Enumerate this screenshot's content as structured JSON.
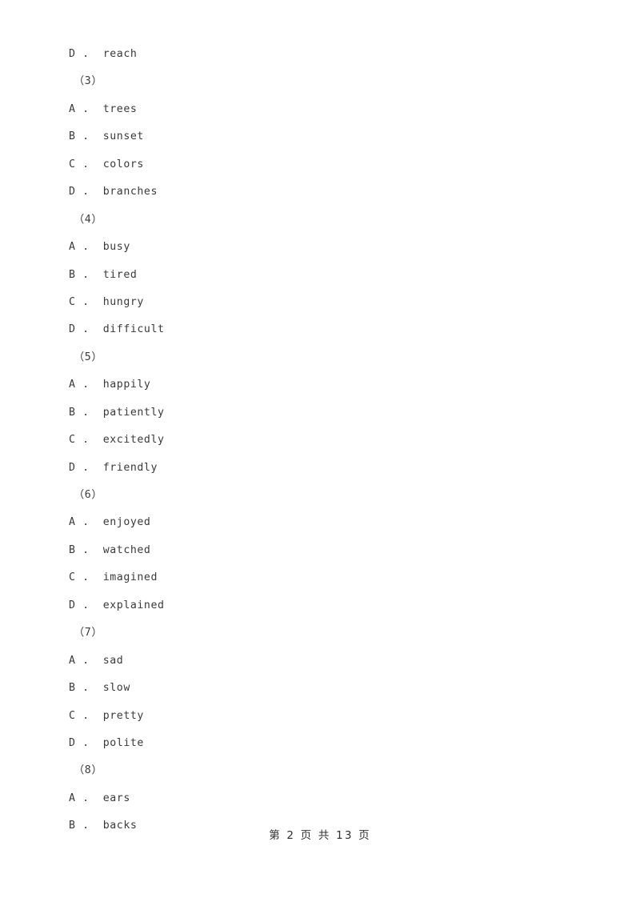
{
  "page": {
    "background_color": "#ffffff",
    "text_color": "#3a3a3a"
  },
  "document": {
    "lines": [
      {
        "kind": "option",
        "letter": "D",
        "separator": " . ",
        "text": "reach",
        "full": "D .  reach"
      },
      {
        "kind": "question",
        "number": "（3）",
        "full": "（3）"
      },
      {
        "kind": "option",
        "letter": "A",
        "separator": " . ",
        "text": "trees",
        "full": "A .  trees"
      },
      {
        "kind": "option",
        "letter": "B",
        "separator": " . ",
        "text": "sunset",
        "full": "B .  sunset"
      },
      {
        "kind": "option",
        "letter": "C",
        "separator": " . ",
        "text": "colors",
        "full": "C .  colors"
      },
      {
        "kind": "option",
        "letter": "D",
        "separator": " . ",
        "text": "branches",
        "full": "D .  branches"
      },
      {
        "kind": "question",
        "number": "（4）",
        "full": "（4）"
      },
      {
        "kind": "option",
        "letter": "A",
        "separator": " . ",
        "text": "busy",
        "full": "A .  busy"
      },
      {
        "kind": "option",
        "letter": "B",
        "separator": " . ",
        "text": "tired",
        "full": "B .  tired"
      },
      {
        "kind": "option",
        "letter": "C",
        "separator": " . ",
        "text": "hungry",
        "full": "C .  hungry"
      },
      {
        "kind": "option",
        "letter": "D",
        "separator": " . ",
        "text": "difficult",
        "full": "D .  difficult"
      },
      {
        "kind": "question",
        "number": "（5）",
        "full": "（5）"
      },
      {
        "kind": "option",
        "letter": "A",
        "separator": " . ",
        "text": "happily",
        "full": "A .  happily"
      },
      {
        "kind": "option",
        "letter": "B",
        "separator": " . ",
        "text": "patiently",
        "full": "B .  patiently"
      },
      {
        "kind": "option",
        "letter": "C",
        "separator": " . ",
        "text": "excitedly",
        "full": "C .  excitedly"
      },
      {
        "kind": "option",
        "letter": "D",
        "separator": " . ",
        "text": "friendly",
        "full": "D .  friendly"
      },
      {
        "kind": "question",
        "number": "（6）",
        "full": "（6）"
      },
      {
        "kind": "option",
        "letter": "A",
        "separator": " . ",
        "text": "enjoyed",
        "full": "A .  enjoyed"
      },
      {
        "kind": "option",
        "letter": "B",
        "separator": " . ",
        "text": "watched",
        "full": "B .  watched"
      },
      {
        "kind": "option",
        "letter": "C",
        "separator": " . ",
        "text": "imagined",
        "full": "C .  imagined"
      },
      {
        "kind": "option",
        "letter": "D",
        "separator": " . ",
        "text": "explained",
        "full": "D .  explained"
      },
      {
        "kind": "question",
        "number": "（7）",
        "full": "（7）"
      },
      {
        "kind": "option",
        "letter": "A",
        "separator": " . ",
        "text": "sad",
        "full": "A .  sad"
      },
      {
        "kind": "option",
        "letter": "B",
        "separator": " . ",
        "text": "slow",
        "full": "B .  slow"
      },
      {
        "kind": "option",
        "letter": "C",
        "separator": " . ",
        "text": "pretty",
        "full": "C .  pretty"
      },
      {
        "kind": "option",
        "letter": "D",
        "separator": " . ",
        "text": "polite",
        "full": "D .  polite"
      },
      {
        "kind": "question",
        "number": "（8）",
        "full": "（8）"
      },
      {
        "kind": "option",
        "letter": "A",
        "separator": " . ",
        "text": "ears",
        "full": "A .  ears"
      },
      {
        "kind": "option",
        "letter": "B",
        "separator": " . ",
        "text": "backs",
        "full": "B .  backs"
      }
    ]
  },
  "footer": {
    "text": "第 2 页 共 13 页",
    "current_page": "2",
    "total_pages": "13"
  }
}
